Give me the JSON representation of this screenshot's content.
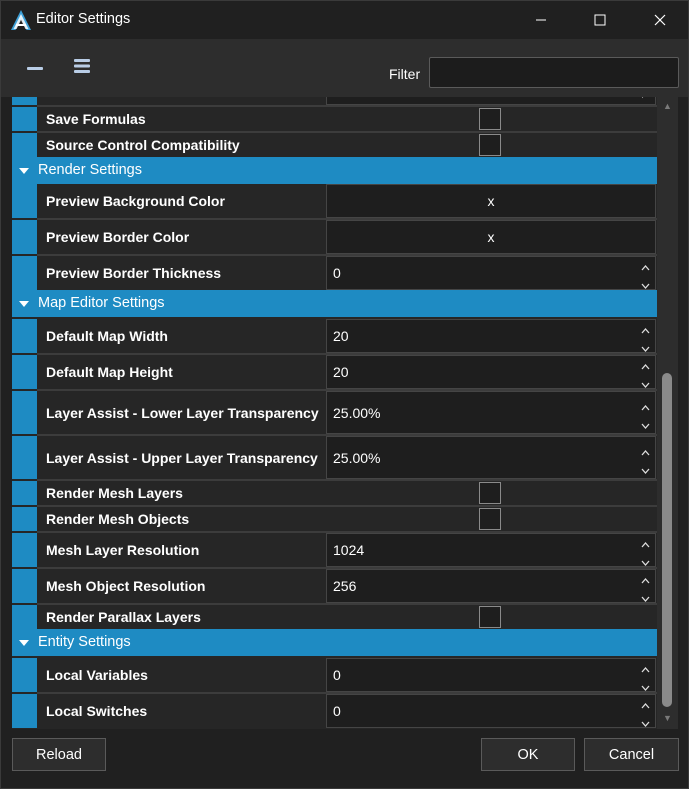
{
  "window": {
    "title": "Editor Settings"
  },
  "toolbar": {
    "filter_label": "Filter",
    "filter_value": ""
  },
  "grid": {
    "partial_top_row": {
      "label": "",
      "value": ""
    },
    "rows_before": [
      {
        "label": "Save Formulas",
        "type": "checkbox",
        "checked": false
      },
      {
        "label": "Source Control Compatibility",
        "type": "checkbox",
        "checked": false
      }
    ],
    "categories": [
      {
        "label": "Render Settings",
        "rows": [
          {
            "label": "Preview Background Color",
            "type": "color",
            "value": "x"
          },
          {
            "label": "Preview Border Color",
            "type": "color",
            "value": "x"
          },
          {
            "label": "Preview Border Thickness",
            "type": "number",
            "value": "0"
          }
        ]
      },
      {
        "label": "Map Editor Settings",
        "rows": [
          {
            "label": "Default Map Width",
            "type": "number",
            "value": "20"
          },
          {
            "label": "Default Map Height",
            "type": "number",
            "value": "20"
          },
          {
            "label": "Layer Assist - Lower Layer Transparency",
            "type": "number",
            "value": "25.00%"
          },
          {
            "label": "Layer Assist - Upper Layer Transparency",
            "type": "number",
            "value": "25.00%"
          },
          {
            "label": "Render Mesh Layers",
            "type": "checkbox",
            "checked": false
          },
          {
            "label": "Render Mesh Objects",
            "type": "checkbox",
            "checked": false
          },
          {
            "label": "Mesh Layer Resolution",
            "type": "number",
            "value": "1024"
          },
          {
            "label": "Mesh Object Resolution",
            "type": "number",
            "value": "256"
          },
          {
            "label": "Render Parallax Layers",
            "type": "checkbox",
            "checked": false
          }
        ]
      },
      {
        "label": "Entity Settings",
        "rows": [
          {
            "label": "Local Variables",
            "type": "number",
            "value": "0"
          },
          {
            "label": "Local Switches",
            "type": "number",
            "value": "0"
          }
        ]
      }
    ]
  },
  "footer": {
    "reload_label": "Reload",
    "ok_label": "OK",
    "cancel_label": "Cancel"
  },
  "colors": {
    "accent": "#1e8bc3",
    "background": "#202020",
    "panel": "#262626"
  },
  "icons": {
    "app": "app-logo-icon",
    "collapse": "collapse-all-icon",
    "list": "list-view-icon"
  }
}
